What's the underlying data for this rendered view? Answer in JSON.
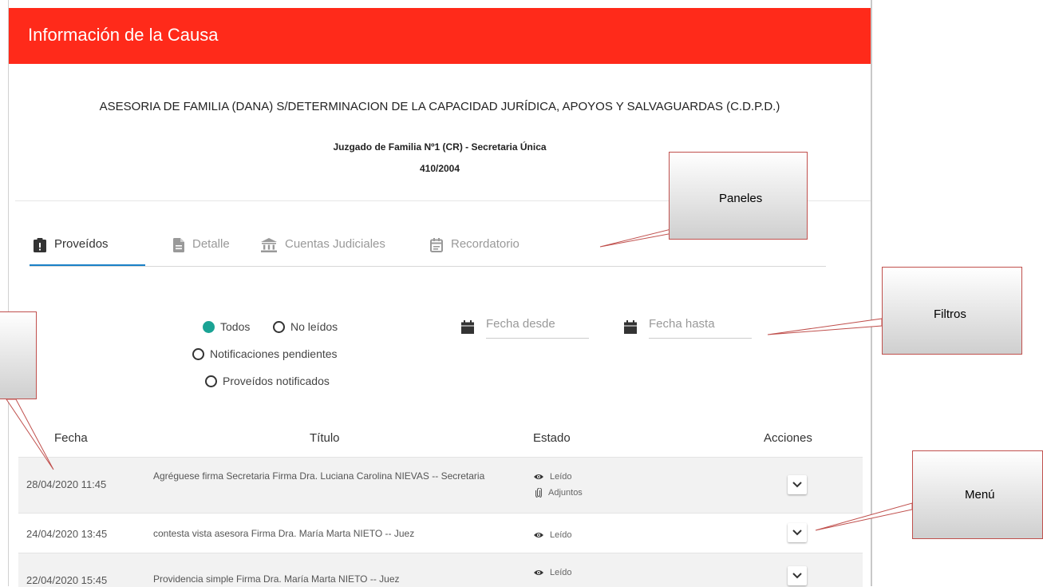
{
  "header": {
    "title": "Información de la Causa",
    "bg": "#ff2a1a"
  },
  "case": {
    "title": "ASESORIA DE FAMILIA (DANA) S/DETERMINACION DE LA CAPACIDAD JURÍDICA, APOYOS Y SALVAGUARDAS (C.D.P.D.)",
    "court": "Juzgado de Familia Nº1 (CR) -  Secretaria Única",
    "number": "410/2004"
  },
  "tabs": [
    {
      "label": "Proveídos",
      "icon": "clipboard-alert-icon",
      "active": true
    },
    {
      "label": "Detalle",
      "icon": "document-icon",
      "active": false
    },
    {
      "label": "Cuentas Judiciales",
      "icon": "bank-icon",
      "active": false
    },
    {
      "label": "Recordatorio",
      "icon": "calendar-note-icon",
      "active": false
    }
  ],
  "filters": {
    "radios": [
      {
        "label": "Todos",
        "checked": true
      },
      {
        "label": "No leídos",
        "checked": false
      },
      {
        "label": "Notificaciones pendientes",
        "checked": false
      },
      {
        "label": "Proveídos notificados",
        "checked": false
      }
    ],
    "date_from_placeholder": "Fecha desde",
    "date_to_placeholder": "Fecha hasta"
  },
  "table": {
    "headers": {
      "fecha": "Fecha",
      "titulo": "Título",
      "estado": "Estado",
      "acciones": "Acciones"
    },
    "rows": [
      {
        "fecha": "28/04/2020 11:45",
        "titulo": "Agréguese firma Secretaria Firma Dra. Luciana Carolina NIEVAS -- Secretaria",
        "estado": [
          "Leído",
          "Adjuntos"
        ]
      },
      {
        "fecha": "24/04/2020 13:45",
        "titulo": "contesta vista asesora Firma Dra. María Marta NIETO -- Juez",
        "estado": [
          "Leído"
        ]
      },
      {
        "fecha": "22/04/2020 15:45",
        "titulo": "Providencia simple Firma Dra. María Marta NIETO -- Juez",
        "estado": [
          "Leído"
        ]
      }
    ]
  },
  "callouts": {
    "paneles": "Paneles",
    "filtros": "Filtros",
    "menu": "Menú"
  },
  "colors": {
    "accent_teal": "#1aa394",
    "tab_underline": "#1a80c7",
    "callout_border": "#c0504d"
  }
}
